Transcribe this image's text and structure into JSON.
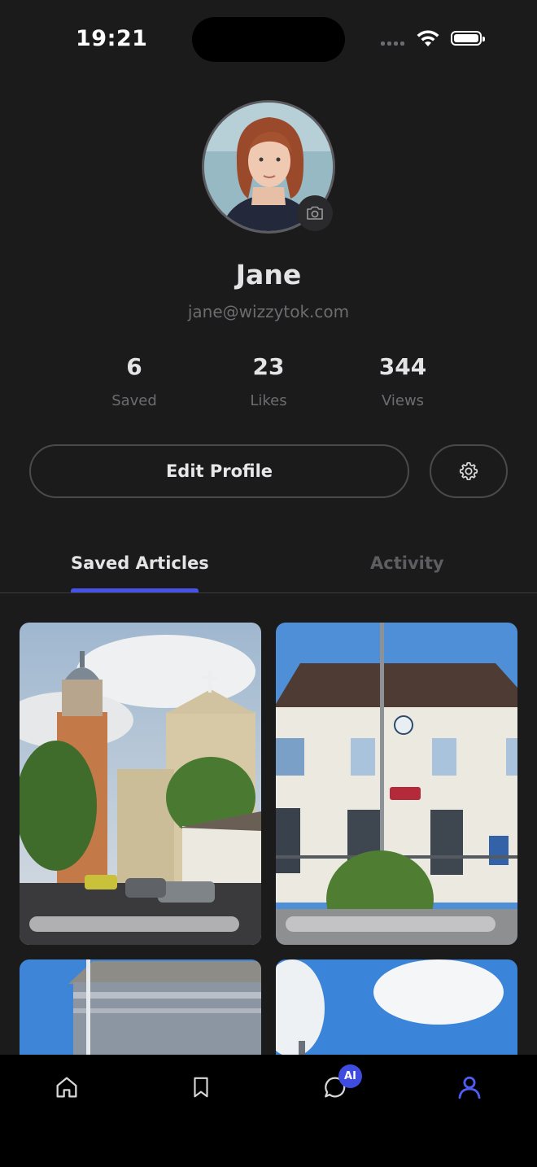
{
  "status_bar": {
    "time": "19:21"
  },
  "profile": {
    "name": "Jane",
    "email": "jane@wizzytok.com",
    "avatar_icon": "camera-icon"
  },
  "stats": [
    {
      "value": "6",
      "label": "Saved"
    },
    {
      "value": "23",
      "label": "Likes"
    },
    {
      "value": "344",
      "label": "Views"
    }
  ],
  "actions": {
    "edit_label": "Edit Profile",
    "settings_icon": "gear-icon"
  },
  "tabs": [
    {
      "label": "Saved Articles",
      "active": true
    },
    {
      "label": "Activity",
      "active": false
    }
  ],
  "articles": [
    {
      "image": "church-photo"
    },
    {
      "image": "sncf-station-photo"
    },
    {
      "image": "old-building-photo"
    },
    {
      "image": "sky-photo"
    }
  ],
  "nav": {
    "items": [
      "home-icon",
      "bookmark-icon",
      "chat-ai-icon",
      "profile-icon"
    ],
    "ai_badge": "AI",
    "accent_color": "#4753e6"
  }
}
